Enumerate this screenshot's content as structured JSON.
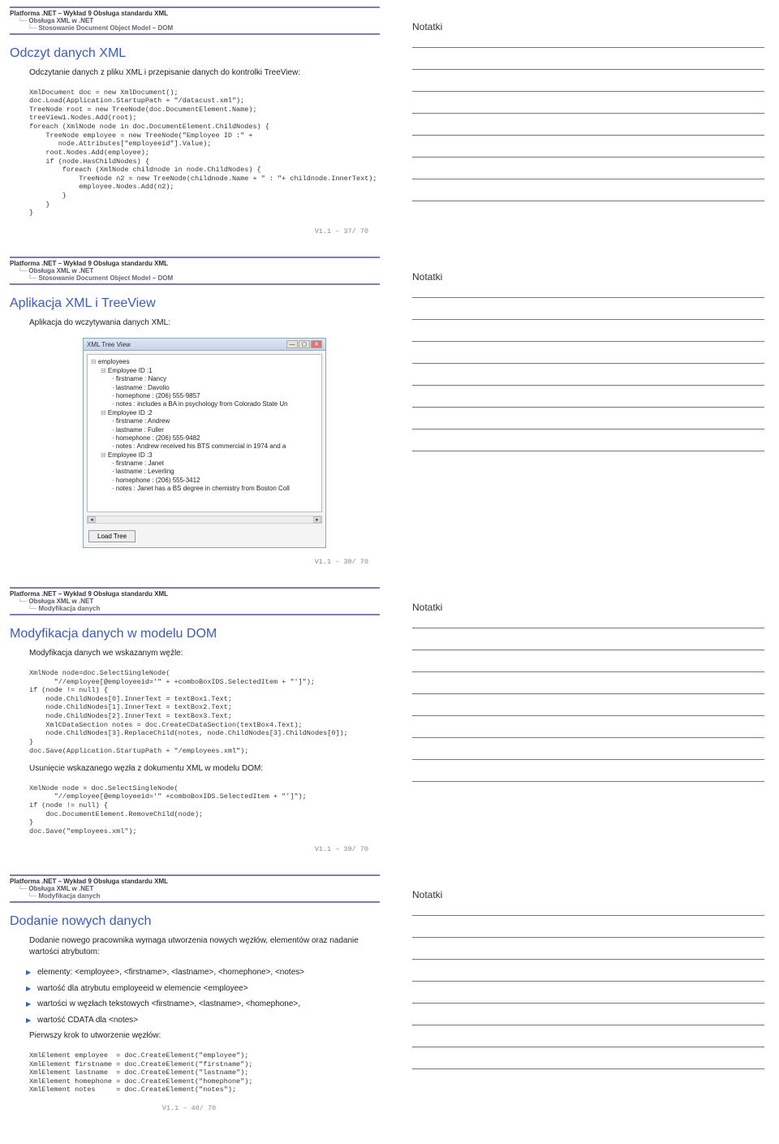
{
  "slides": [
    {
      "breadcrumb": {
        "l1": "Platforma .NET – Wykład 9  Obsługa standardu XML",
        "l2": "Obsługa XML w .NET",
        "l3": "Stosowanie Document Object Model – DOM"
      },
      "title": "Odczyt danych XML",
      "intro": "Odczytanie danych z pliku XML i przepisanie danych do kontrolki TreeView:",
      "code": "XmlDocument doc = new XmlDocument();\ndoc.Load(Application.StartupPath + \"/datacust.xml\");\nTreeNode root = new TreeNode(doc.DocumentElement.Name);\ntreeView1.Nodes.Add(root);\nforeach (XmlNode node in doc.DocumentElement.ChildNodes) {\n    TreeNode employee = new TreeNode(\"Employee ID :\" +\n       node.Attributes[\"employeeid\"].Value);\n    root.Nodes.Add(employee);\n    if (node.HasChildNodes) {\n        foreach (XmlNode childnode in node.ChildNodes) {\n            TreeNode n2 = new TreeNode(childnode.Name + \" : \"+ childnode.InnerText);\n            employee.Nodes.Add(n2);\n        }\n    }\n}",
      "footer": "V1.1 – 37/ 70",
      "notes_title": "Notatki"
    },
    {
      "breadcrumb": {
        "l1": "Platforma .NET – Wykład 9  Obsługa standardu XML",
        "l2": "Obsługa XML w .NET",
        "l3": "Stosowanie Document Object Model – DOM"
      },
      "title": "Aplikacja XML i TreeView",
      "intro": "Aplikacja do wczytywania danych XML:",
      "app": {
        "title": "XML Tree View",
        "tree": [
          {
            "lvl": 0,
            "box": "⊟",
            "text": "employees"
          },
          {
            "lvl": 1,
            "box": "⊟",
            "text": "Employee ID :1"
          },
          {
            "lvl": 2,
            "box": "",
            "text": "firstname : Nancy"
          },
          {
            "lvl": 2,
            "box": "",
            "text": "lastname : Davolio"
          },
          {
            "lvl": 2,
            "box": "",
            "text": "homephone : (206) 555-9857"
          },
          {
            "lvl": 2,
            "box": "",
            "text": "notes : includes a BA in psychology from Colorado State Un"
          },
          {
            "lvl": 1,
            "box": "⊟",
            "text": "Employee ID :2"
          },
          {
            "lvl": 2,
            "box": "",
            "text": "firstname : Andrew"
          },
          {
            "lvl": 2,
            "box": "",
            "text": "lastname : Fuller"
          },
          {
            "lvl": 2,
            "box": "",
            "text": "homephone : (206) 555-9482"
          },
          {
            "lvl": 2,
            "box": "",
            "text": "notes : Andrew received his BTS commercial in 1974 and a"
          },
          {
            "lvl": 1,
            "box": "⊟",
            "text": "Employee ID :3"
          },
          {
            "lvl": 2,
            "box": "",
            "text": "firstname : Janet"
          },
          {
            "lvl": 2,
            "box": "",
            "text": "lastname : Leverling"
          },
          {
            "lvl": 2,
            "box": "",
            "text": "homephone : (206) 555-3412"
          },
          {
            "lvl": 2,
            "box": "",
            "text": "notes : Janet has a BS degree in chemistry from Boston Coll"
          }
        ],
        "button": "Load Tree"
      },
      "footer": "V1.1 – 38/ 70",
      "notes_title": "Notatki"
    },
    {
      "breadcrumb": {
        "l1": "Platforma .NET – Wykład 9  Obsługa standardu XML",
        "l2": "Obsługa XML w .NET",
        "l3": "Modyfikacja danych"
      },
      "title": "Modyfikacja danych w modelu DOM",
      "intro": "Modyfikacja danych we wskazanym węźle:",
      "code": "XmlNode node=doc.SelectSingleNode(\n      \"//employee[@employeeid='\" + +comboBoxIDS.SelectedItem + \"']\");\nif (node != null) {\n    node.ChildNodes[0].InnerText = textBox1.Text;\n    node.ChildNodes[1].InnerText = textBox2.Text;\n    node.ChildNodes[2].InnerText = textBox3.Text;\n    XmlCDataSection notes = doc.CreateCDataSection(textBox4.Text);\n    node.ChildNodes[3].ReplaceChild(notes, node.ChildNodes[3].ChildNodes[0]);\n}\ndoc.Save(Application.StartupPath + \"/employees.xml\");",
      "intro2": "Usunięcie wskazanego węzła z dokumentu XML w modelu DOM:",
      "code2": "XmlNode node = doc.SelectSingleNode(\n      \"//employee[@employeeid='\" +comboBoxIDS.SelectedItem + \"']\");\nif (node != null) {\n    doc.DocumentElement.RemoveChild(node);\n}\ndoc.Save(\"employees.xml\");",
      "footer": "V1.1 – 39/ 70",
      "notes_title": "Notatki"
    },
    {
      "breadcrumb": {
        "l1": "Platforma .NET – Wykład 9  Obsługa standardu XML",
        "l2": "Obsługa XML w .NET",
        "l3": "Modyfikacja danych"
      },
      "title": "Dodanie nowych danych",
      "intro": "Dodanie nowego pracownika wymaga utworzenia nowych węzłów, elementów oraz nadanie wartości atrybutom:",
      "bullets": [
        "elementy: <employee>, <firstname>, <lastname>, <homephone>, <notes>",
        "wartość dla atrybutu employeeid w elemencie <employee>",
        "wartości w węzłach tekstowych <firstname>, <lastname>, <homephone>,",
        "wartość CDATA dla <notes>"
      ],
      "intro2": "Pierwszy krok to utworzenie węzłów:",
      "code2": "XmlElement employee  = doc.CreateElement(\"employee\");\nXmlElement firstname = doc.CreateElement(\"firstname\");\nXmlElement lastname  = doc.CreateElement(\"lastname\");\nXmlElement homephone = doc.CreateElement(\"homephone\");\nXmlElement notes     = doc.CreateElement(\"notes\");",
      "footer": "V1.1 – 40/ 70",
      "notes_title": "Notatki"
    }
  ]
}
